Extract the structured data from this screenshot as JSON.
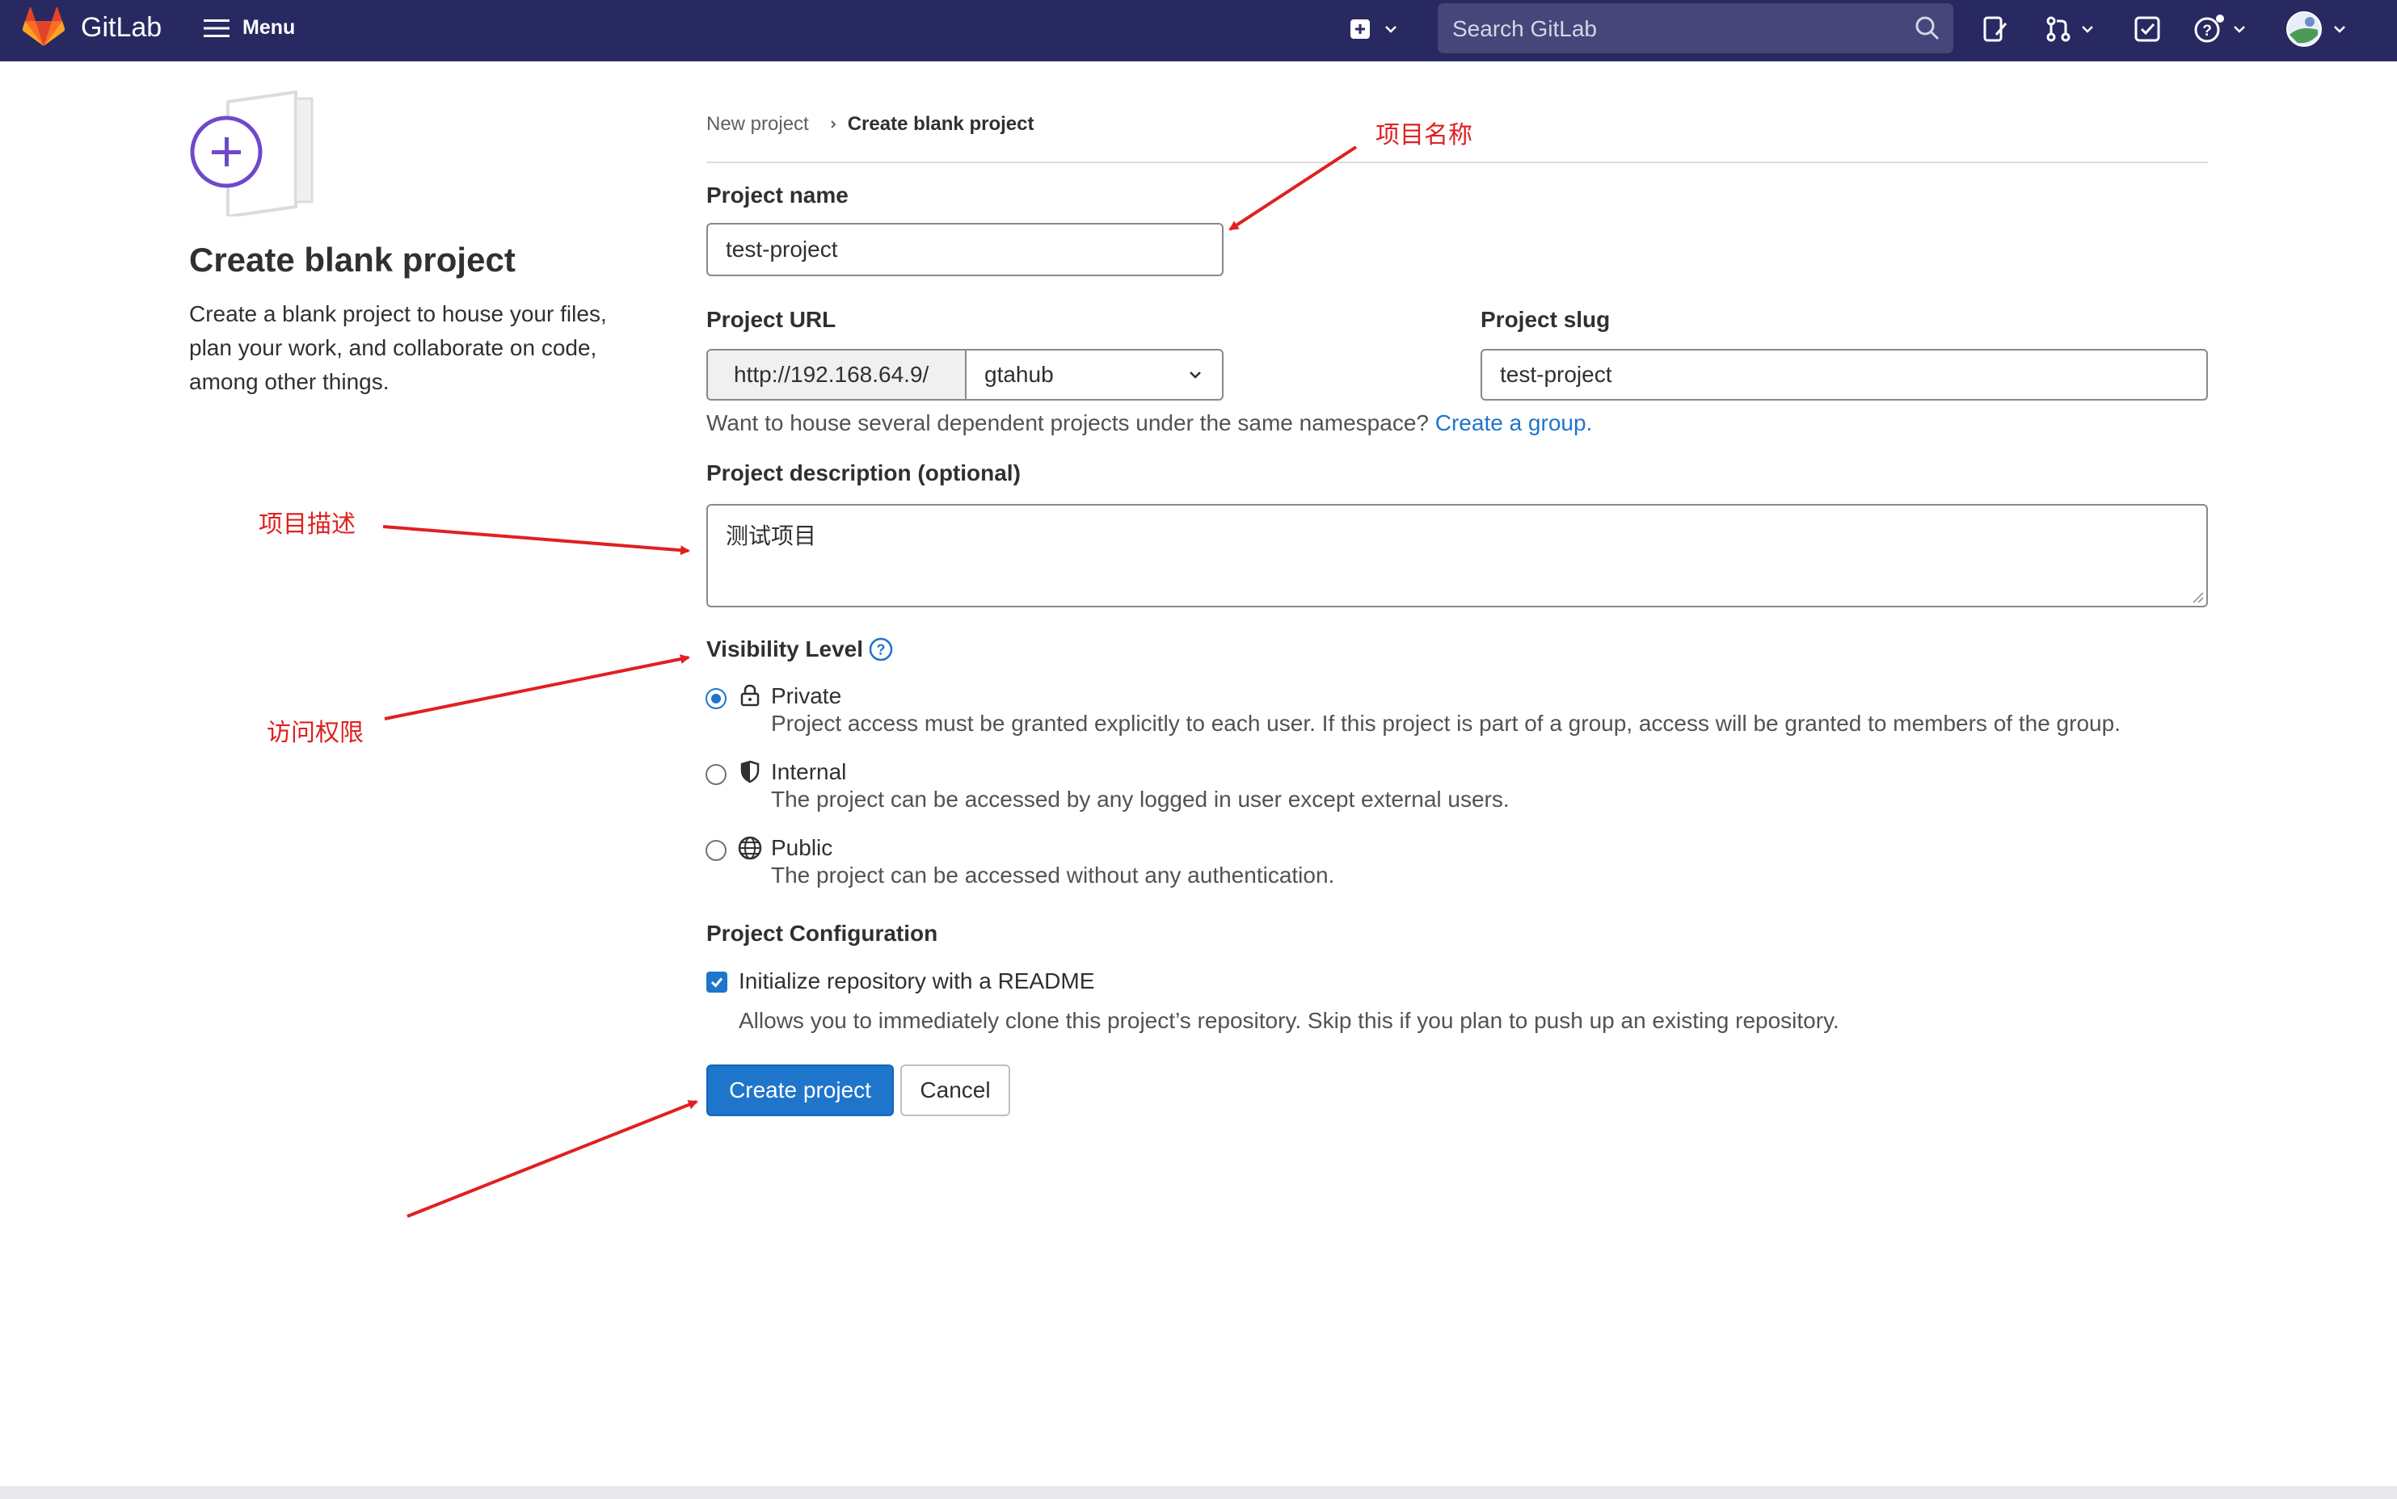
{
  "topbar": {
    "brand": "GitLab",
    "menu_label": "Menu",
    "search_placeholder": "Search GitLab",
    "icons": [
      "plus-square-icon",
      "chevron-down-icon",
      "issues-icon",
      "merge-request-icon",
      "todo-icon",
      "help-icon",
      "avatar"
    ]
  },
  "sidebar": {
    "title": "Create blank project",
    "description": "Create a blank project to house your files, plan your work, and collaborate on code, among other things."
  },
  "breadcrumb": {
    "parent": "New project",
    "current": "Create blank project"
  },
  "form": {
    "project_name_label": "Project name",
    "project_name_value": "test-project",
    "project_url_label": "Project URL",
    "project_url_prefix": "http://192.168.64.9/",
    "namespace_value": "gtahub",
    "project_slug_label": "Project slug",
    "project_slug_value": "test-project",
    "namespace_help": "Want to house several dependent projects under the same namespace?",
    "namespace_help_link": "Create a group.",
    "description_label": "Project description (optional)",
    "description_value": "测试项目",
    "visibility_label": "Visibility Level",
    "visibility_options": [
      {
        "title": "Private",
        "description": "Project access must be granted explicitly to each user. If this project is part of a group, access will be granted to members of the group.",
        "selected": true,
        "icon": "lock-icon"
      },
      {
        "title": "Internal",
        "description": "The project can be accessed by any logged in user except external users.",
        "selected": false,
        "icon": "shield-icon"
      },
      {
        "title": "Public",
        "description": "The project can be accessed without any authentication.",
        "selected": false,
        "icon": "globe-icon"
      }
    ],
    "config_label": "Project Configuration",
    "readme_label": "Initialize repository with a README",
    "readme_checked": true,
    "readme_help": "Allows you to immediately clone this project’s repository. Skip this if you plan to push up an existing repository.",
    "create_button": "Create project",
    "cancel_button": "Cancel"
  },
  "annotations": {
    "project_name": "项目名称",
    "project_description": "项目描述",
    "visibility": "访问权限"
  },
  "colors": {
    "topbar": "#292961",
    "primary": "#1f75cb",
    "annotation": "#e02020"
  }
}
